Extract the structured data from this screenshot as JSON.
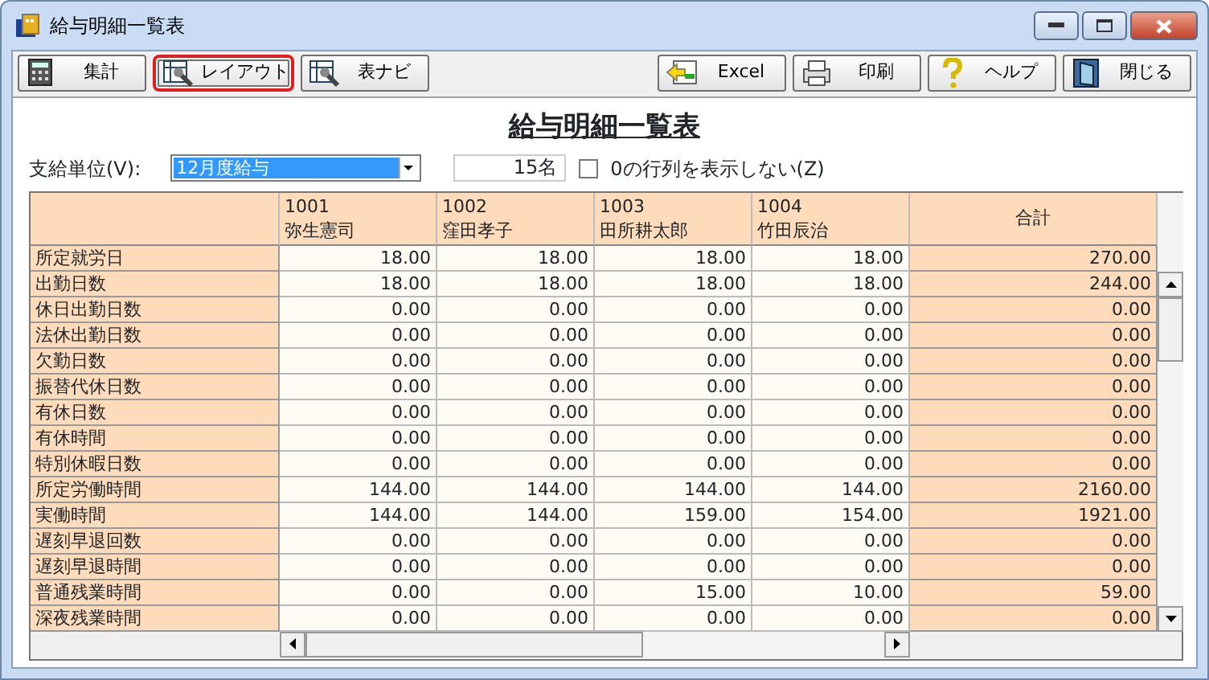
{
  "window": {
    "title": "給与明細一覧表"
  },
  "toolbar": [
    {
      "kind": "calc",
      "label": "集計",
      "highlighted": false
    },
    {
      "kind": "layout",
      "label": "レイアウト",
      "highlighted": true
    },
    {
      "kind": "layout",
      "label": "表ナビ",
      "highlighted": false
    },
    {
      "kind": "excel",
      "label": "Excel",
      "highlighted": false
    },
    {
      "kind": "print",
      "label": "印刷",
      "highlighted": false
    },
    {
      "kind": "help",
      "label": "ヘルプ",
      "highlighted": false
    },
    {
      "kind": "close",
      "label": "閉じる",
      "highlighted": false
    }
  ],
  "report_title": "給与明細一覧表",
  "filter": {
    "label": "支給単位(V):",
    "value": "12月度給与",
    "count": "15名",
    "hide_zero": {
      "label": "0の行列を表示しない(Z)",
      "checked": false
    }
  },
  "table": {
    "columns": [
      {
        "code": "1001",
        "name": "弥生憲司"
      },
      {
        "code": "1002",
        "name": "窪田孝子"
      },
      {
        "code": "1003",
        "name": "田所耕太郎"
      },
      {
        "code": "1004",
        "name": "竹田辰治"
      }
    ],
    "total_header": "合計",
    "rows": [
      {
        "label": "所定就労日",
        "values": [
          "18.00",
          "18.00",
          "18.00",
          "18.00"
        ],
        "total": "270.00"
      },
      {
        "label": "出勤日数",
        "values": [
          "18.00",
          "18.00",
          "18.00",
          "18.00"
        ],
        "total": "244.00"
      },
      {
        "label": "休日出勤日数",
        "values": [
          "0.00",
          "0.00",
          "0.00",
          "0.00"
        ],
        "total": "0.00"
      },
      {
        "label": "法休出勤日数",
        "values": [
          "0.00",
          "0.00",
          "0.00",
          "0.00"
        ],
        "total": "0.00"
      },
      {
        "label": "欠勤日数",
        "values": [
          "0.00",
          "0.00",
          "0.00",
          "0.00"
        ],
        "total": "0.00"
      },
      {
        "label": "振替代休日数",
        "values": [
          "0.00",
          "0.00",
          "0.00",
          "0.00"
        ],
        "total": "0.00"
      },
      {
        "label": "有休日数",
        "values": [
          "0.00",
          "0.00",
          "0.00",
          "0.00"
        ],
        "total": "0.00"
      },
      {
        "label": "有休時間",
        "values": [
          "0.00",
          "0.00",
          "0.00",
          "0.00"
        ],
        "total": "0.00"
      },
      {
        "label": "特別休暇日数",
        "values": [
          "0.00",
          "0.00",
          "0.00",
          "0.00"
        ],
        "total": "0.00"
      },
      {
        "label": "所定労働時間",
        "values": [
          "144.00",
          "144.00",
          "144.00",
          "144.00"
        ],
        "total": "2160.00"
      },
      {
        "label": "実働時間",
        "values": [
          "144.00",
          "144.00",
          "159.00",
          "154.00"
        ],
        "total": "1921.00"
      },
      {
        "label": "遅刻早退回数",
        "values": [
          "0.00",
          "0.00",
          "0.00",
          "0.00"
        ],
        "total": "0.00"
      },
      {
        "label": "遅刻早退時間",
        "values": [
          "0.00",
          "0.00",
          "0.00",
          "0.00"
        ],
        "total": "0.00"
      },
      {
        "label": "普通残業時間",
        "values": [
          "0.00",
          "0.00",
          "15.00",
          "10.00"
        ],
        "total": "59.00"
      },
      {
        "label": "深夜残業時間",
        "values": [
          "0.00",
          "0.00",
          "0.00",
          "0.00"
        ],
        "total": "0.00"
      }
    ]
  }
}
